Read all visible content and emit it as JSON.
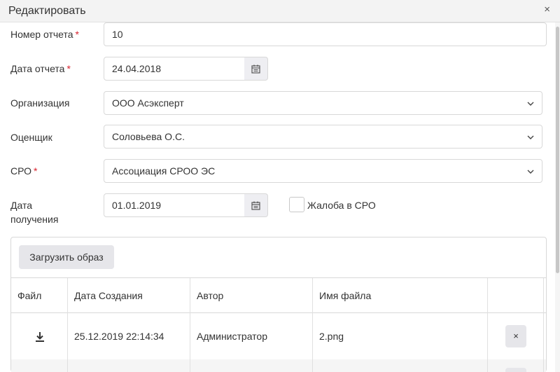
{
  "dialog": {
    "title": "Редактировать",
    "close_glyph": "×"
  },
  "form": {
    "report_number": {
      "label": "Номер отчета",
      "required_mark": "*",
      "value": "10"
    },
    "report_date": {
      "label": "Дата отчета",
      "required_mark": "*",
      "value": "24.04.2018",
      "button_icon": "calendar-icon"
    },
    "organization": {
      "label": "Организация",
      "value": "ООО Асэксперт",
      "icon": "chevron-down-icon"
    },
    "appraiser": {
      "label": "Оценщик",
      "value": "Соловьева О.С.",
      "icon": "chevron-down-icon"
    },
    "sro": {
      "label": "СРО",
      "required_mark": "*",
      "value": "Ассоциация СРОО ЭС",
      "icon": "chevron-down-icon"
    },
    "received_date": {
      "label_line1": "Дата",
      "label_line2": "получения",
      "value": "01.01.2019",
      "button_icon": "calendar-icon"
    },
    "complaint": {
      "label": "Жалоба в СРО",
      "checked": false
    }
  },
  "files": {
    "upload_label": "Загрузить образ",
    "columns": [
      "Файл",
      "Дата Создания",
      "Автор",
      "Имя файла",
      ""
    ],
    "rows": [
      {
        "file_icon": "download-icon",
        "created": "25.12.2019 22:14:34",
        "author": "Администратор",
        "filename": "2.png",
        "delete_glyph": "×"
      }
    ]
  },
  "colors": {
    "required": "#d9232e",
    "button_bg": "#e6e6ea",
    "border": "#d8d8d8"
  }
}
